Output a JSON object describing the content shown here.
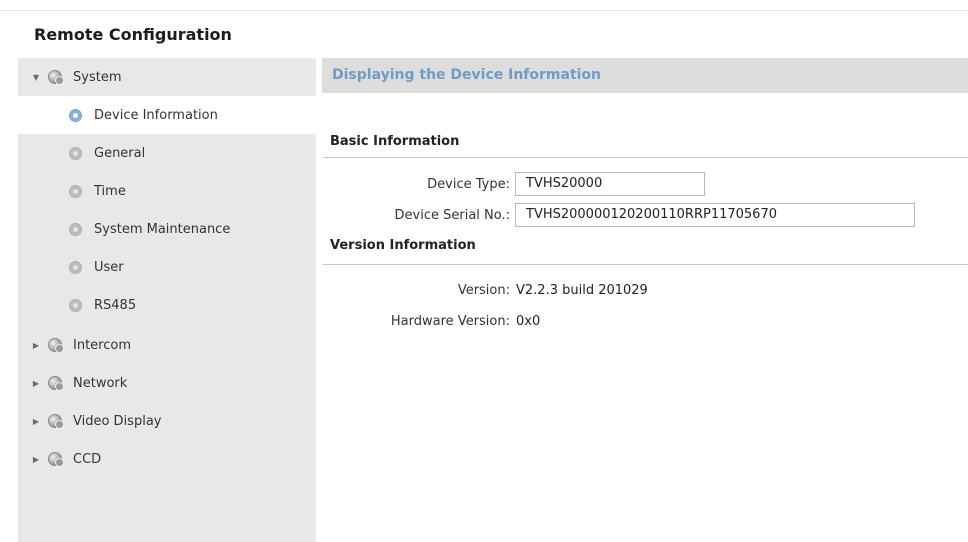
{
  "app": {
    "title": "Remote Configuration"
  },
  "sidebar": {
    "system": {
      "label": "System",
      "children": [
        "Device Information",
        "General",
        "Time",
        "System Maintenance",
        "User",
        "RS485"
      ]
    },
    "others": [
      "Intercom",
      "Network",
      "Video Display",
      "CCD"
    ]
  },
  "main": {
    "header": "Displaying the Device Information",
    "basic": {
      "title": "Basic Information",
      "device_type_label": "Device Type:",
      "device_type_value": "TVHS20000",
      "serial_label": "Device Serial No.:",
      "serial_value": "TVHS200000120200110RRP11705670"
    },
    "version": {
      "title": "Version Information",
      "version_label": "Version:",
      "version_value": "V2.2.3 build 201029",
      "hardware_label": "Hardware Version:",
      "hardware_value": "0x0"
    }
  },
  "colors": {
    "header_text": "#6f9cc6",
    "sidebar_bg": "#e8e8e8",
    "selected_bg": "#ffffff"
  },
  "icons": {
    "expanded": "triangle-down",
    "collapsed": "triangle-right",
    "category": "globe-gear-icon",
    "page": "gear-icon"
  }
}
